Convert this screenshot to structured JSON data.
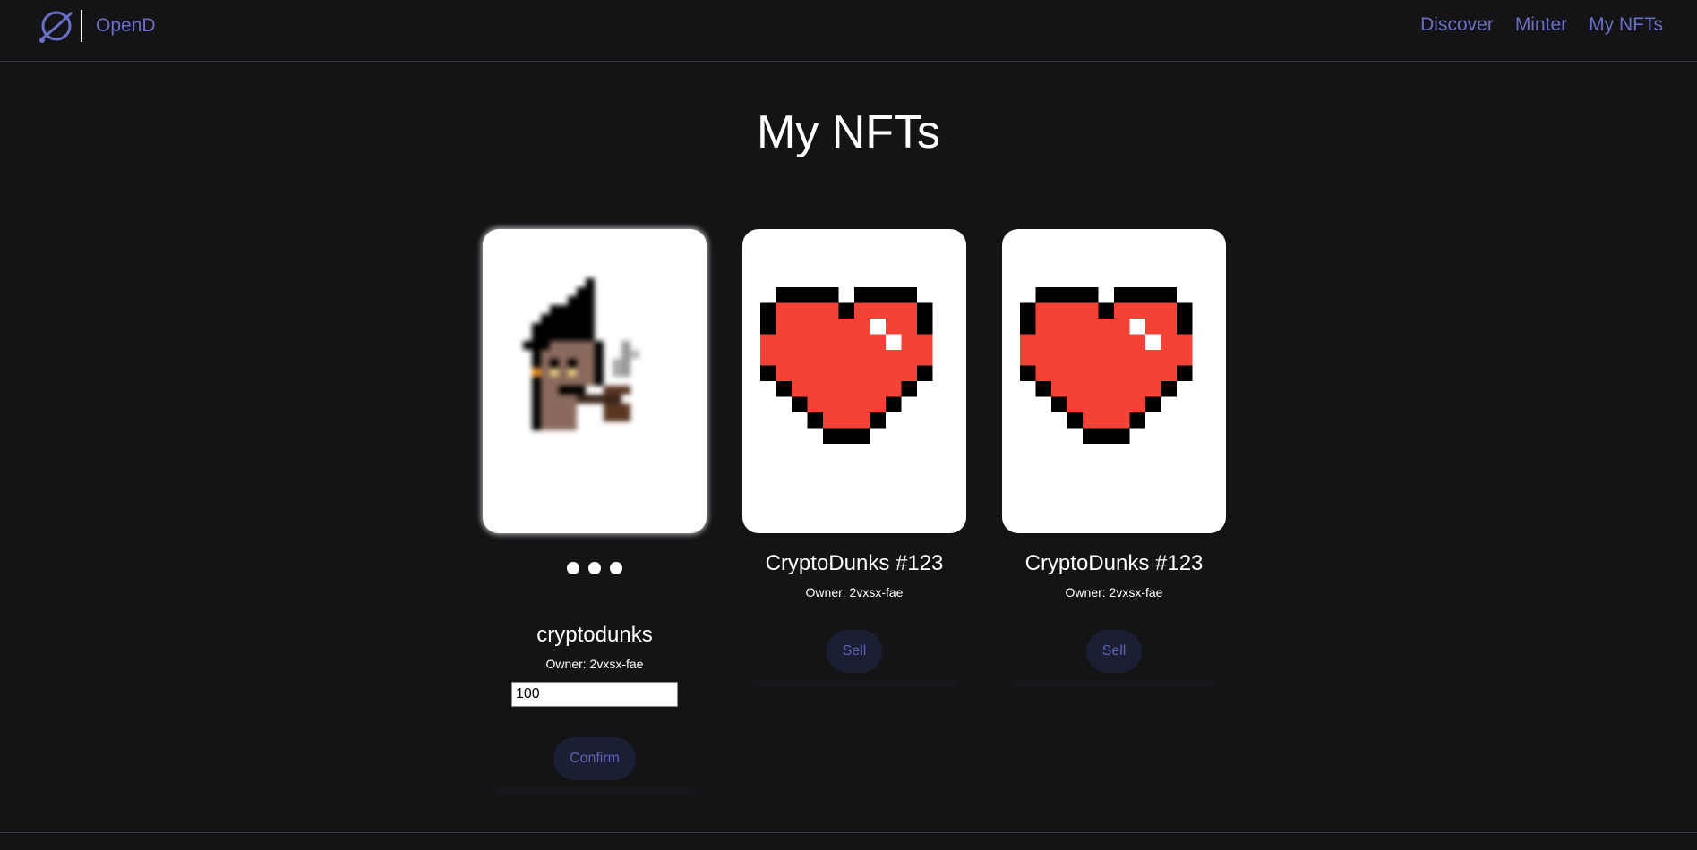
{
  "header": {
    "brand": "OpenD",
    "nav": [
      "Discover",
      "Minter",
      "My NFTs"
    ]
  },
  "page": {
    "title": "My NFTs"
  },
  "cards": [
    {
      "name": "cryptodunks",
      "owner": "Owner: 2vxsx-fae",
      "image": "pixel-punk-with-pipe",
      "loading": true,
      "price_value": "100",
      "button": "Confirm"
    },
    {
      "name": "CryptoDunks #123",
      "owner": "Owner: 2vxsx-fae",
      "image": "pixel-heart",
      "button": "Sell"
    },
    {
      "name": "CryptoDunks #123",
      "owner": "Owner: 2vxsx-fae",
      "image": "pixel-heart",
      "button": "Sell"
    }
  ],
  "colors": {
    "background": "#141417",
    "accent": "#6a6fc6",
    "button_bg": "#1b1f33",
    "heart_red": "#f44336"
  }
}
